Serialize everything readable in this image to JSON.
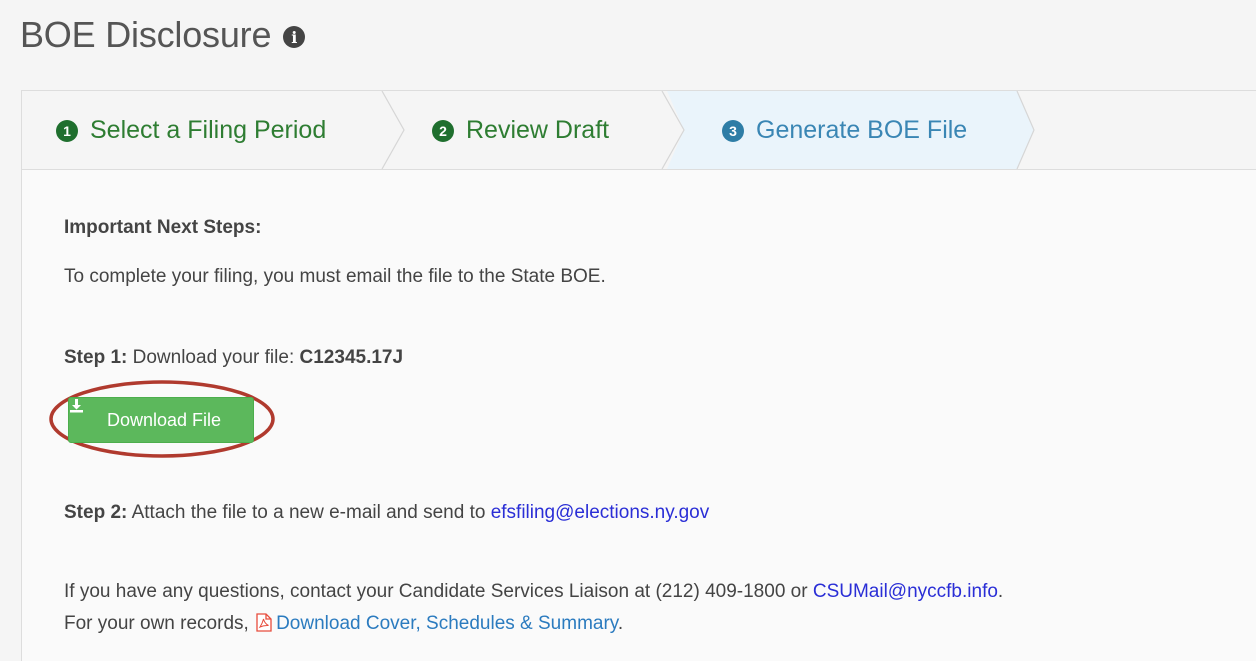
{
  "header": {
    "title": "BOE Disclosure",
    "info_icon": "info-circle-icon"
  },
  "wizard": {
    "steps": [
      {
        "num": "1",
        "label": "Select a Filing Period",
        "state": "done"
      },
      {
        "num": "2",
        "label": "Review Draft",
        "state": "done"
      },
      {
        "num": "3",
        "label": "Generate BOE File",
        "state": "active"
      }
    ]
  },
  "content": {
    "heading": "Important Next Steps:",
    "intro": "To complete your filing, you must email the file to the State BOE.",
    "step1_label": "Step 1:",
    "step1_text": " Download your file: ",
    "step1_filename": "C12345.17J",
    "download_button": "Download File",
    "download_icon": "download-icon",
    "step2_label": "Step 2:",
    "step2_text": " Attach the file to a new e-mail and send to ",
    "step2_email": "efsfiling@elections.ny.gov",
    "questions_text": "If you have any questions, contact your Candidate Services Liaison at (212) 409-1800 or ",
    "questions_email": "CSUMail@nyccfb.info",
    "questions_end": ".",
    "records_text": "For your own records, ",
    "records_icon": "pdf-file-icon",
    "records_link": "Download Cover, Schedules & Summary",
    "records_end": "."
  },
  "colors": {
    "done_green": "#2e7d32",
    "active_blue": "#3a86b4",
    "button_green": "#5cb85c",
    "highlight_ring": "#b03a2e",
    "link_blue": "#2a2ed6"
  }
}
